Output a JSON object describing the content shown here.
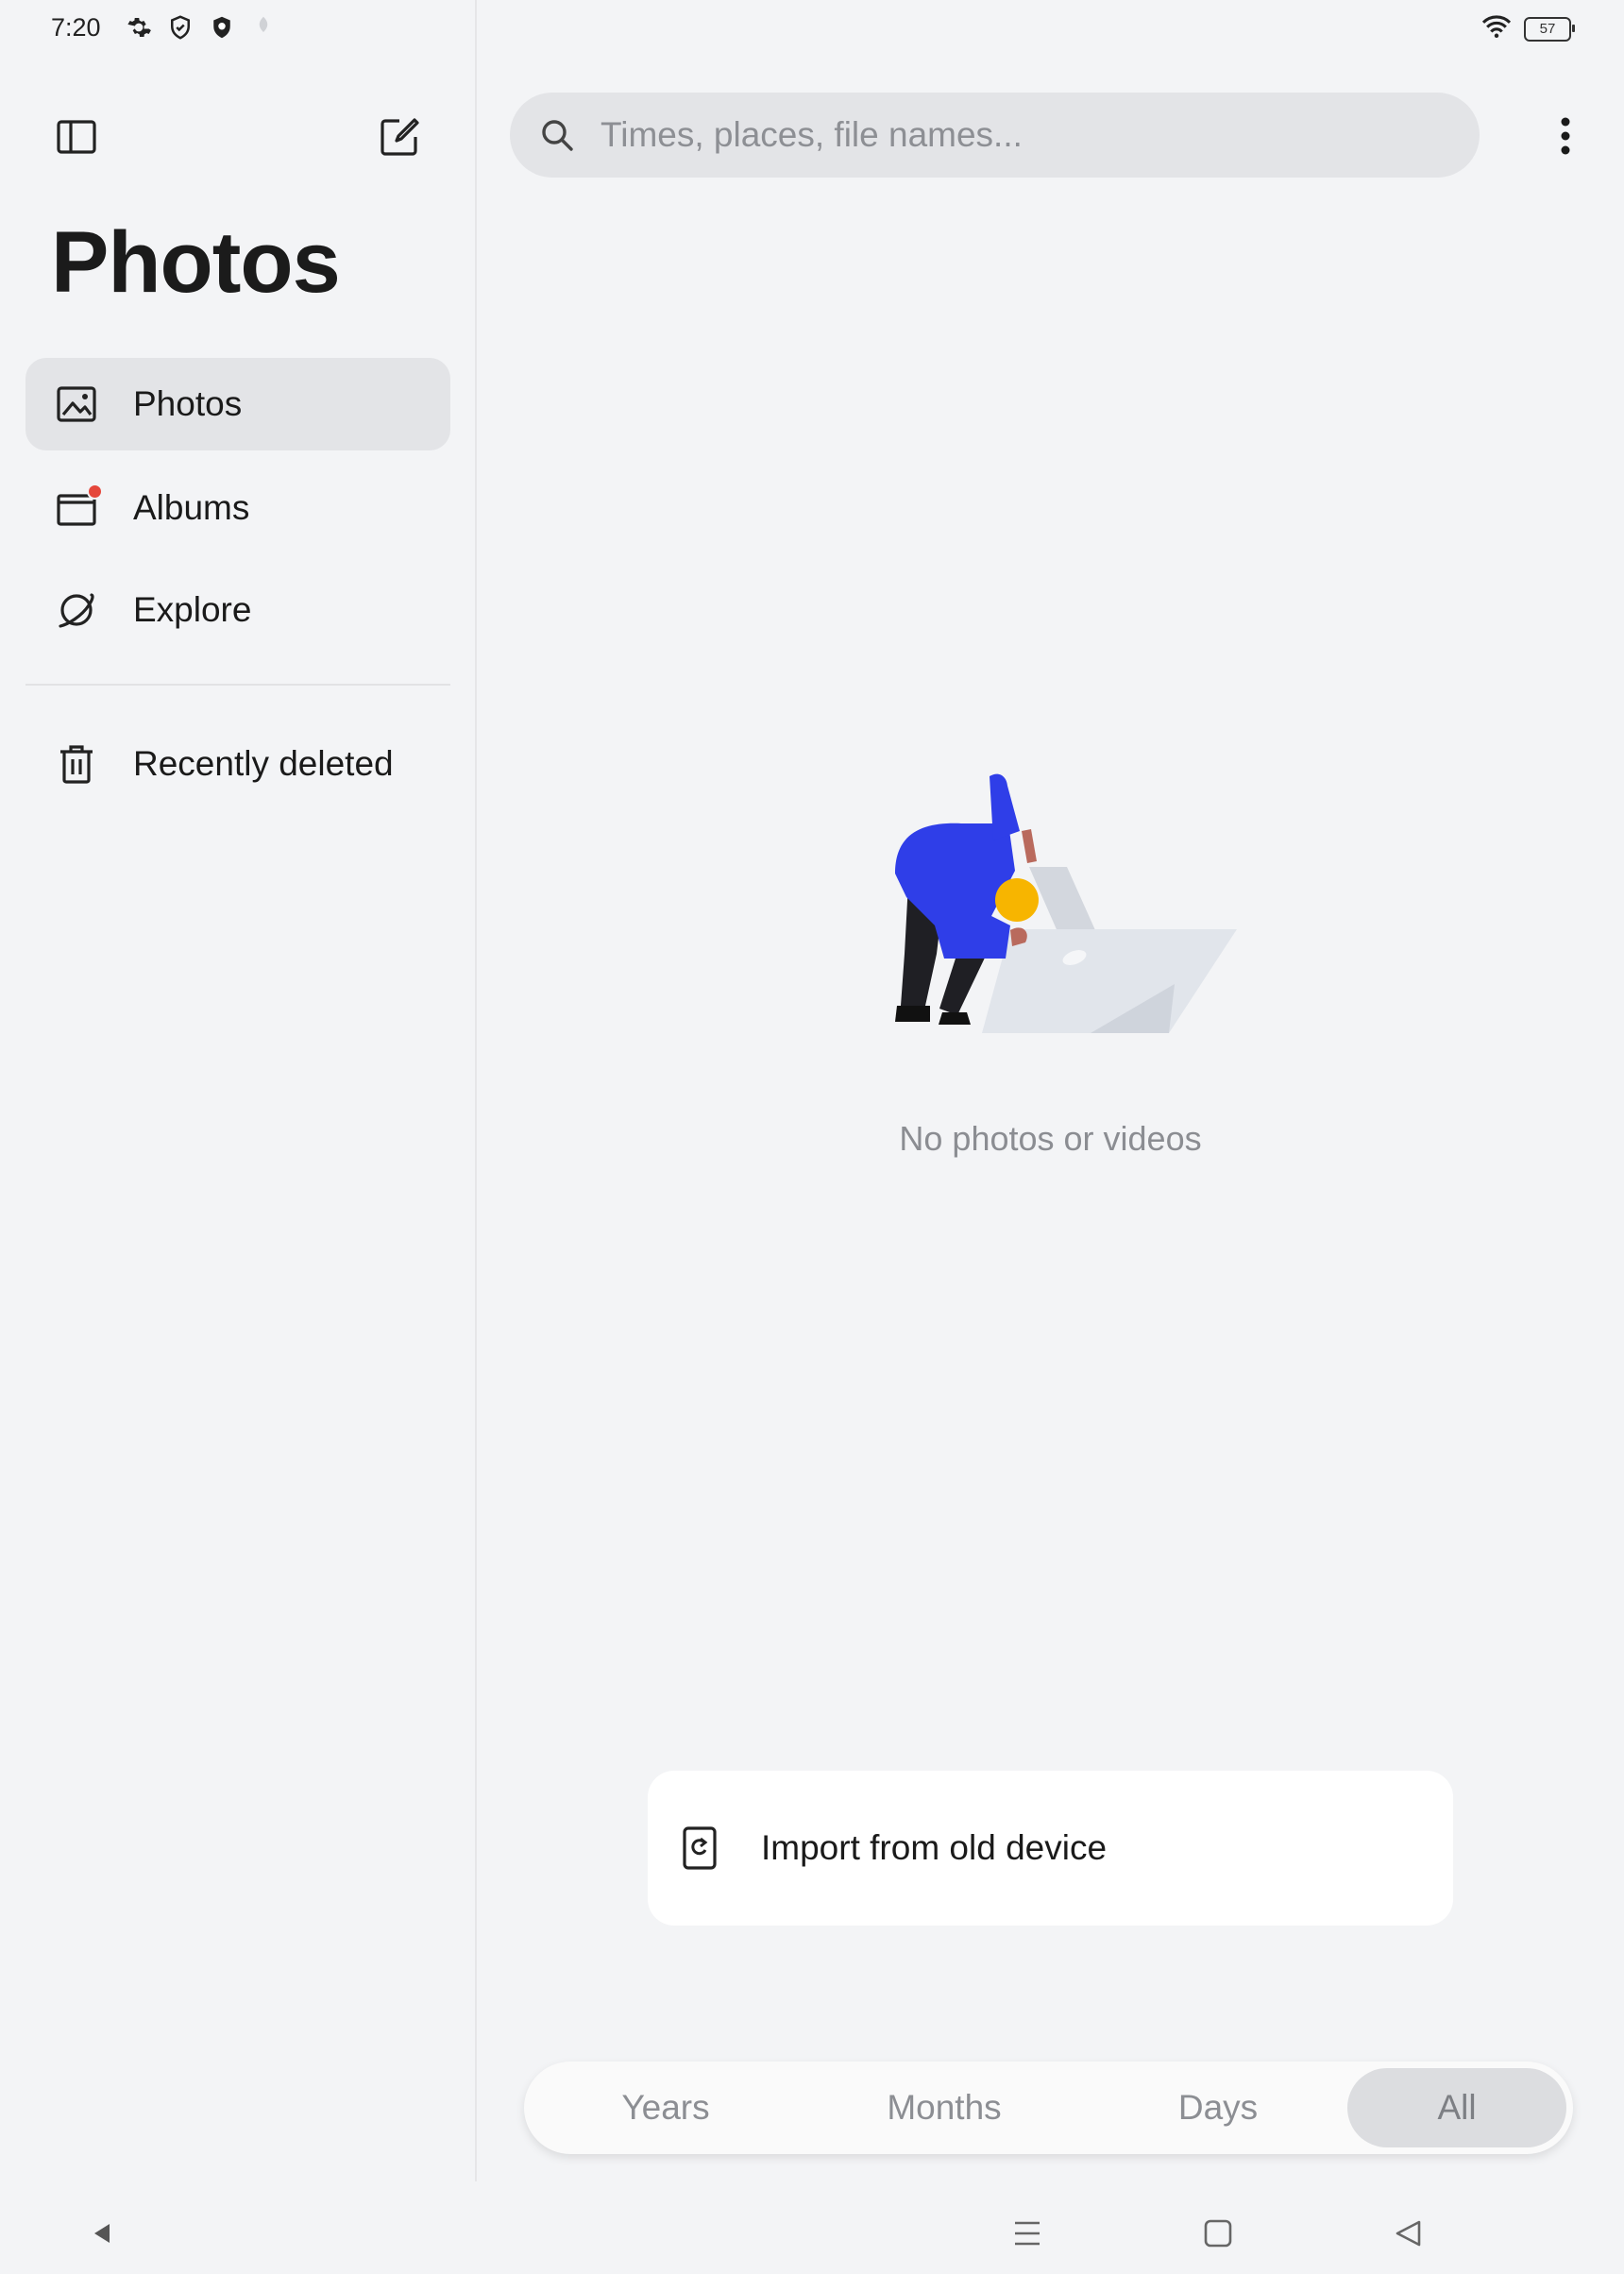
{
  "status_bar": {
    "time": "7:20",
    "icons": [
      "gear-icon",
      "shield-outline-icon",
      "shield-filled-icon",
      "leaf-icon"
    ],
    "right_icons": [
      "wifi-icon",
      "battery-icon"
    ],
    "battery": "57"
  },
  "sidebar": {
    "title": "Photos",
    "items": [
      {
        "label": "Photos",
        "icon": "image-icon",
        "active": true
      },
      {
        "label": "Albums",
        "icon": "album-icon",
        "badge": true
      },
      {
        "label": "Explore",
        "icon": "planet-icon"
      },
      {
        "label": "Recently deleted",
        "icon": "trash-icon"
      }
    ]
  },
  "search": {
    "placeholder": "Times, places, file names..."
  },
  "empty_state": {
    "message": "No photos or videos"
  },
  "import_card": {
    "label": "Import from old device"
  },
  "view_tabs": {
    "years": "Years",
    "months": "Months",
    "days": "Days",
    "all": "All",
    "selected": "All"
  },
  "colors": {
    "background": "#f3f4f6",
    "active_nav": "#e3e4e7",
    "badge": "#e5473b",
    "illustration_blue": "#2f3ee8",
    "illustration_yellow": "#f7b500"
  }
}
